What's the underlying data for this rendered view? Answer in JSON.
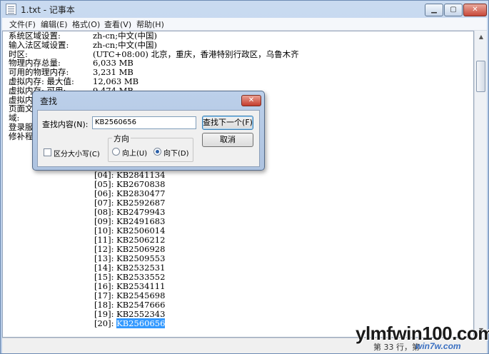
{
  "window": {
    "title": "1.txt - 记事本",
    "min_label": "▁",
    "max_label": "▢",
    "close_label": "✕"
  },
  "menu": [
    "文件(F)",
    "编辑(E)",
    "格式(O)",
    "查看(V)",
    "帮助(H)"
  ],
  "content": {
    "lines": [
      {
        "label": "系统区域设置:",
        "value": "zh-cn;中文(中国)"
      },
      {
        "label": "输入法区域设置:",
        "value": "zh-cn;中文(中国)"
      },
      {
        "label": "时区:",
        "value": "(UTC+08:00) 北京，重庆，香港特别行政区，乌鲁木齐"
      },
      {
        "label": "物理内存总量:",
        "value": "6,033 MB"
      },
      {
        "label": "可用的物理内存:",
        "value": "3,231 MB"
      },
      {
        "label": "虚拟内存: 最大值:",
        "value": "12,063 MB"
      },
      {
        "label": "虚拟内存: 可用:",
        "value": "9,474 MB"
      },
      {
        "label": "虚拟内",
        "value": ""
      },
      {
        "label": "页面文",
        "value": ""
      },
      {
        "label": "域:",
        "value": ""
      },
      {
        "label": "登录服",
        "value": ""
      },
      {
        "label": "修补程",
        "value": ""
      }
    ],
    "hotfixes": [
      "[04]: KB2841134",
      "[05]: KB2670838",
      "[06]: KB2830477",
      "[07]: KB2592687",
      "[08]: KB2479943",
      "[09]: KB2491683",
      "[10]: KB2506014",
      "[11]: KB2506212",
      "[12]: KB2506928",
      "[13]: KB2509553",
      "[14]: KB2532531",
      "[15]: KB2533552",
      "[16]: KB2534111",
      "[17]: KB2545698",
      "[18]: KB2547666",
      "[19]: KB2552343"
    ],
    "last_hotfix_prefix": "[20]: ",
    "last_hotfix_selected": "KB2560656"
  },
  "statusbar": {
    "text": "第 33 行，第"
  },
  "find_dialog": {
    "title": "查找",
    "close_label": "✕",
    "find_label": "查找内容(N):",
    "find_value": "KB2560656",
    "find_next_label": "查找下一个(F)",
    "cancel_label": "取消",
    "direction_label": "方向",
    "up_label": "向上(U)",
    "down_label": "向下(D)",
    "direction_selected": "down",
    "match_case_label": "区分大小写(C)",
    "match_case_checked": false
  },
  "watermark": {
    "text": "ylmfwin100.com",
    "sub": "win7w.com"
  }
}
